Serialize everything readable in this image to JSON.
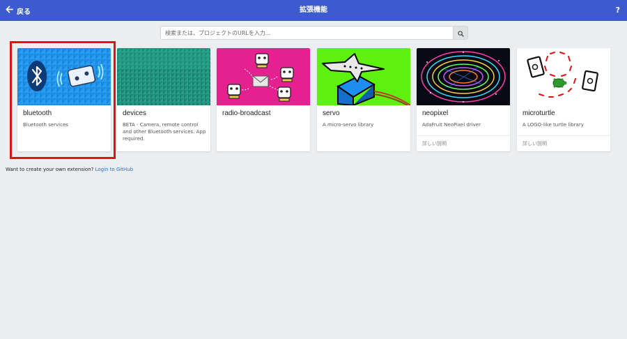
{
  "header": {
    "back_label": "戻る",
    "title": "拡張機能",
    "help_label": "?"
  },
  "search": {
    "placeholder": "検索または、プロジェクトのURLを入力..."
  },
  "cards": [
    {
      "name": "bluetooth",
      "description": "Bluetooth services",
      "image": "bluetooth-microbit-illustration"
    },
    {
      "name": "devices",
      "description": "BETA - Camera, remote control and other Bluetooth services. App required.",
      "image": "teal-triangle-pattern"
    },
    {
      "name": "radio-broadcast",
      "description": "",
      "image": "radio-robots-illustration"
    },
    {
      "name": "servo",
      "description": "A micro-servo library",
      "image": "servo-motor-illustration"
    },
    {
      "name": "neopixel",
      "description": "AdaFruit NeoPixel driver",
      "more_label": "詳しい説明",
      "image": "neopixel-led-photo"
    },
    {
      "name": "microturtle",
      "description": "A LOGO-like turtle library",
      "more_label": "詳しい説明",
      "image": "turtle-drawing-illustration"
    }
  ],
  "footer": {
    "text": "Want to create your own extension?",
    "link_label": "Login to GitHub"
  },
  "colors": {
    "topbar": "#3d5bce",
    "highlight": "#e31212",
    "link": "#1f6ed4"
  }
}
